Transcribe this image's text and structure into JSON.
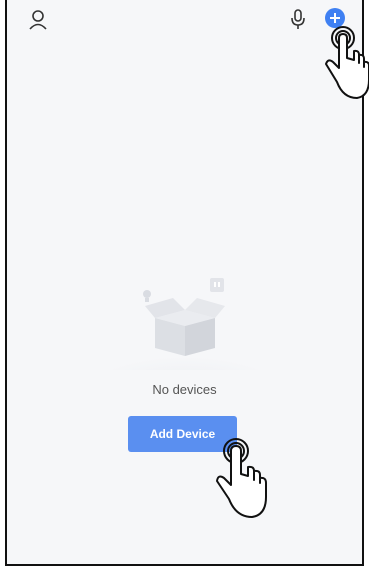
{
  "topbar": {
    "profile_icon": "person-icon",
    "mic_icon": "microphone-icon",
    "add_icon": "plus-circle-icon"
  },
  "empty_state": {
    "message": "No devices",
    "button_label": "Add Device"
  },
  "colors": {
    "accent": "#5a8ff0",
    "background": "#f6f7f9"
  }
}
